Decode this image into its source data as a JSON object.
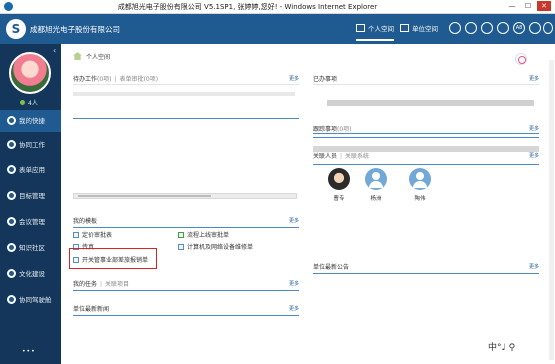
{
  "window": {
    "title": "成都旭光电子股份有限公司 V5.1SP1, 张婷婷,您好! - Windows Internet Explorer",
    "min": "—",
    "max": "☐",
    "close": "✕"
  },
  "header": {
    "logo_glyph": "S",
    "company": "成都旭光电子股份有限公司",
    "tabs": [
      {
        "label": "个人空间",
        "active": true
      },
      {
        "label": "单位空间",
        "active": false
      }
    ],
    "buttons": [
      "",
      "",
      "",
      "",
      "A8",
      "",
      ""
    ]
  },
  "sidebar": {
    "collapse_glyph": "‹",
    "online": "4人",
    "items": [
      {
        "label": "我的快捷",
        "active": true
      },
      {
        "label": "协同工作",
        "active": false
      },
      {
        "label": "表单应用",
        "active": false
      },
      {
        "label": "目标管理",
        "active": false
      },
      {
        "label": "会议管理",
        "active": false
      },
      {
        "label": "知识社区",
        "active": false
      },
      {
        "label": "文化建设",
        "active": false
      },
      {
        "label": "协同驾驶舱",
        "active": false
      }
    ],
    "bottom": "•••"
  },
  "breadcrumb": "个人空间",
  "panels": {
    "pending": {
      "title": "待办工作",
      "count": "(0项)",
      "sep": "|",
      "tab2": "表单审批",
      "tab2_count": "(0项)",
      "more": "更多"
    },
    "done": {
      "title": "已办事项",
      "more": "更多"
    },
    "tracking": {
      "title": "跟踪事项",
      "count": "(0项)",
      "more": "更多"
    },
    "contacts": {
      "title": "关联人员",
      "sep": "|",
      "tab2": "关联系统",
      "more": "更多"
    },
    "templates": {
      "title": "我的模板",
      "more": "更多",
      "items": [
        {
          "label": "定价审批表",
          "col": 0,
          "row": 0,
          "green": false
        },
        {
          "label": "流程上线审批单",
          "col": 1,
          "row": 0,
          "green": true
        },
        {
          "label": "传真",
          "col": 0,
          "row": 1,
          "green": false
        },
        {
          "label": "计算机及网络设备维修单",
          "col": 1,
          "row": 1,
          "green": false
        },
        {
          "label": "开关管事业部差旅报销单",
          "col": 0,
          "row": 2,
          "green": false
        }
      ]
    },
    "tasks": {
      "title": "我的任务",
      "sep": "|",
      "tab2": "关联项目",
      "more": "更多"
    },
    "news": {
      "title": "单位最新新闻",
      "more": "更多"
    },
    "bulletin": {
      "title": "单位最新公告",
      "more": "更多"
    }
  },
  "people": [
    {
      "name": "曹专",
      "photo": true
    },
    {
      "name": "杨洲",
      "photo": false
    },
    {
      "name": "陶伟",
      "photo": false
    }
  ],
  "corner_text": "中°♩ ⚲"
}
